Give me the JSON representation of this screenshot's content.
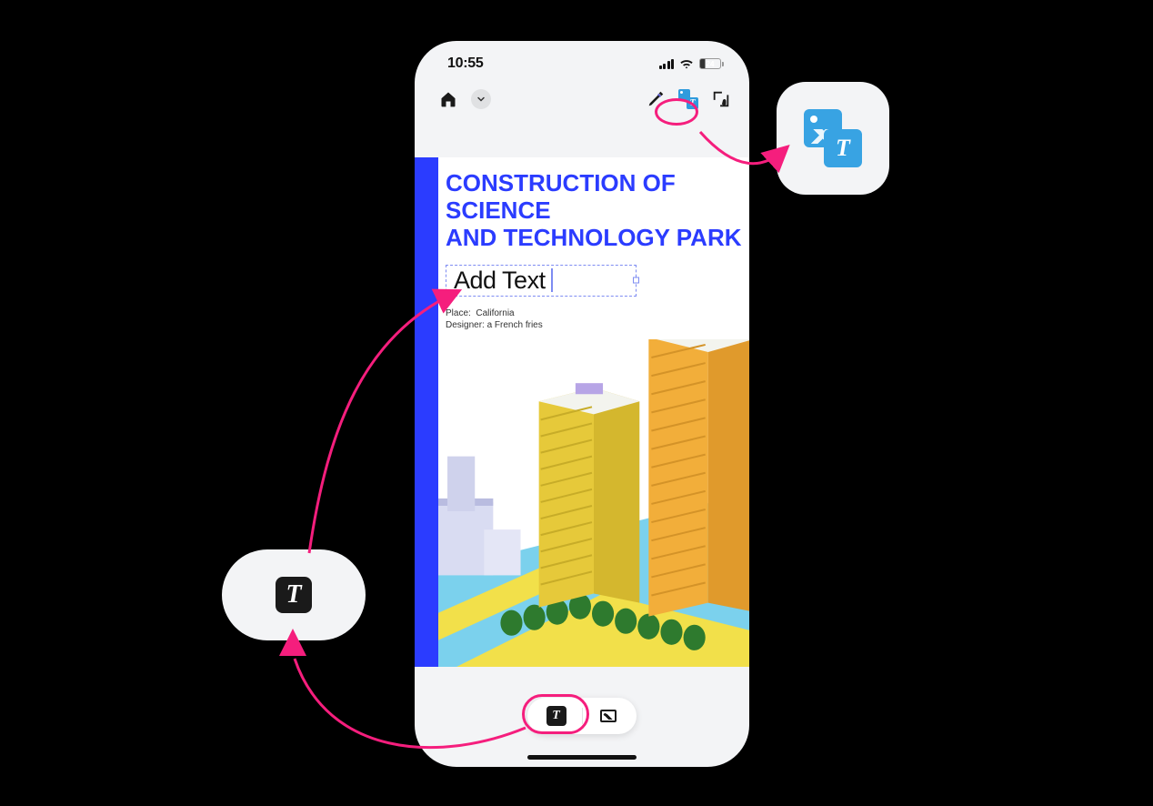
{
  "statusbar": {
    "time": "10:55",
    "battery_pct": "24"
  },
  "toolbar": {
    "home_icon": "home-icon",
    "dropdown_icon": "chevron-down-icon",
    "highlighter_icon": "highlighter-icon",
    "image_text_icon": "image-text-icon",
    "crop_icon": "crop-touch-icon"
  },
  "document": {
    "title_line1": "CONSTRUCTION OF SCIENCE",
    "title_line2": "AND TECHNOLOGY PARK",
    "add_text_placeholder": "Add Text",
    "meta_place_label": "Place:",
    "meta_place_value": "California",
    "meta_designer_label": "Designer:",
    "meta_designer_value": "a French fries"
  },
  "dock": {
    "text_tool": "text-tool-icon",
    "image_tool": "image-tool-icon"
  },
  "callouts": {
    "left_bubble": "text-tool-icon",
    "right_bubble": "image-text-icon"
  },
  "colors": {
    "accent_blue": "#2B3CFF",
    "highlight_pink": "#F51E7D",
    "icon_teal": "#38A3E3"
  }
}
